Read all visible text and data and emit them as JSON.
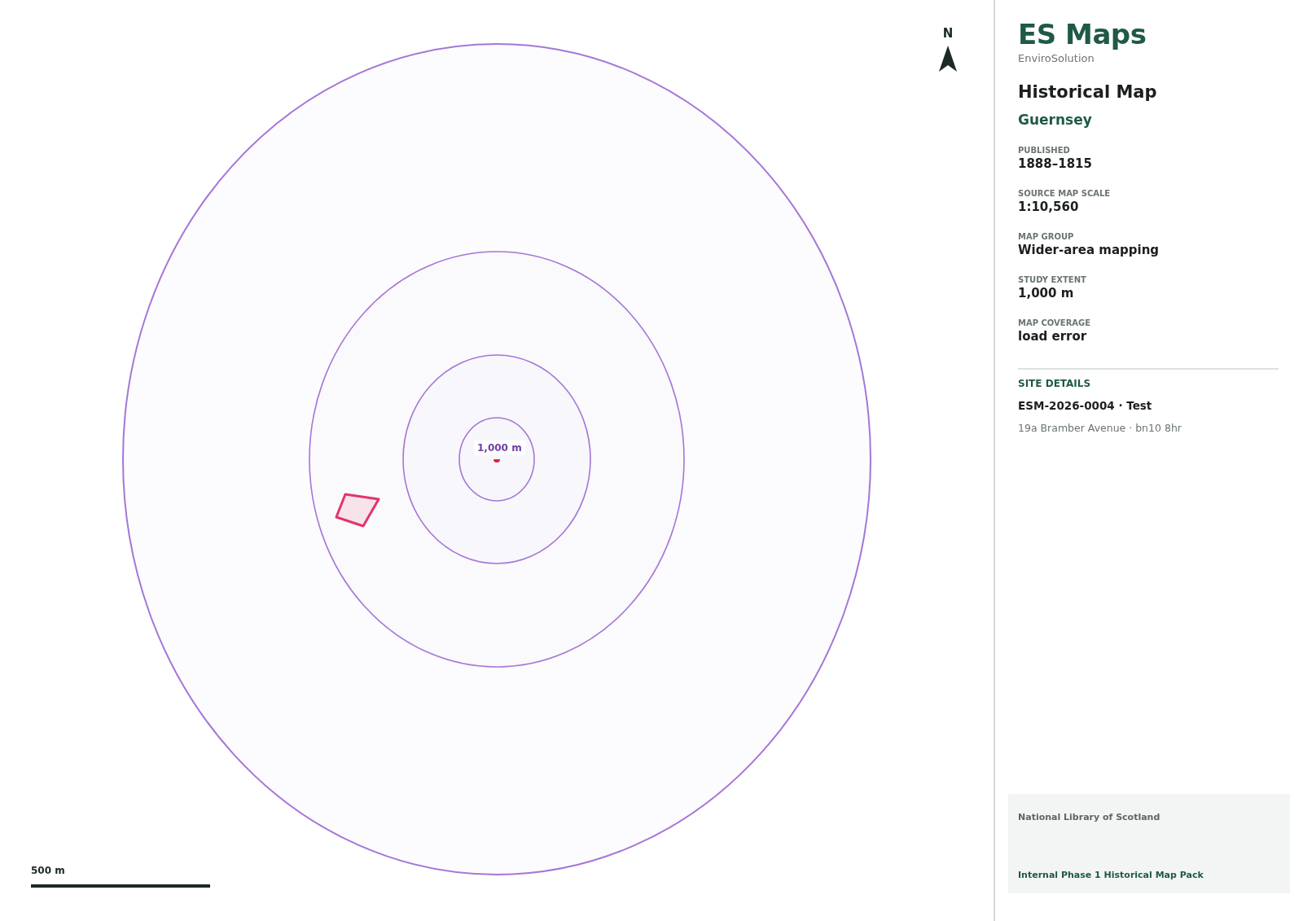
{
  "map": {
    "north_label": "N",
    "buffer_label": "1,000 m",
    "scale_bar": {
      "label": "500 m"
    }
  },
  "sidebar": {
    "brand": "ES Maps",
    "company": "EnviroSolution",
    "title": "Historical Map",
    "location": "Guernsey",
    "fields": [
      {
        "label": "PUBLISHED",
        "value": "1888–1815"
      },
      {
        "label": "SOURCE MAP SCALE",
        "value": "1:10,560"
      },
      {
        "label": "MAP GROUP",
        "value": "Wider-area mapping"
      },
      {
        "label": "STUDY EXTENT",
        "value": "1,000 m"
      },
      {
        "label": "MAP COVERAGE",
        "value": "load error"
      }
    ],
    "site_details": {
      "heading": "SITE DETAILS",
      "reference": "ESM-2026-0004 · Test",
      "address": "19a Bramber Avenue · bn10 8hr"
    },
    "footer": {
      "source": "National Library of Scotland",
      "pack": "Internal Phase 1 Historical Map Pack"
    }
  }
}
